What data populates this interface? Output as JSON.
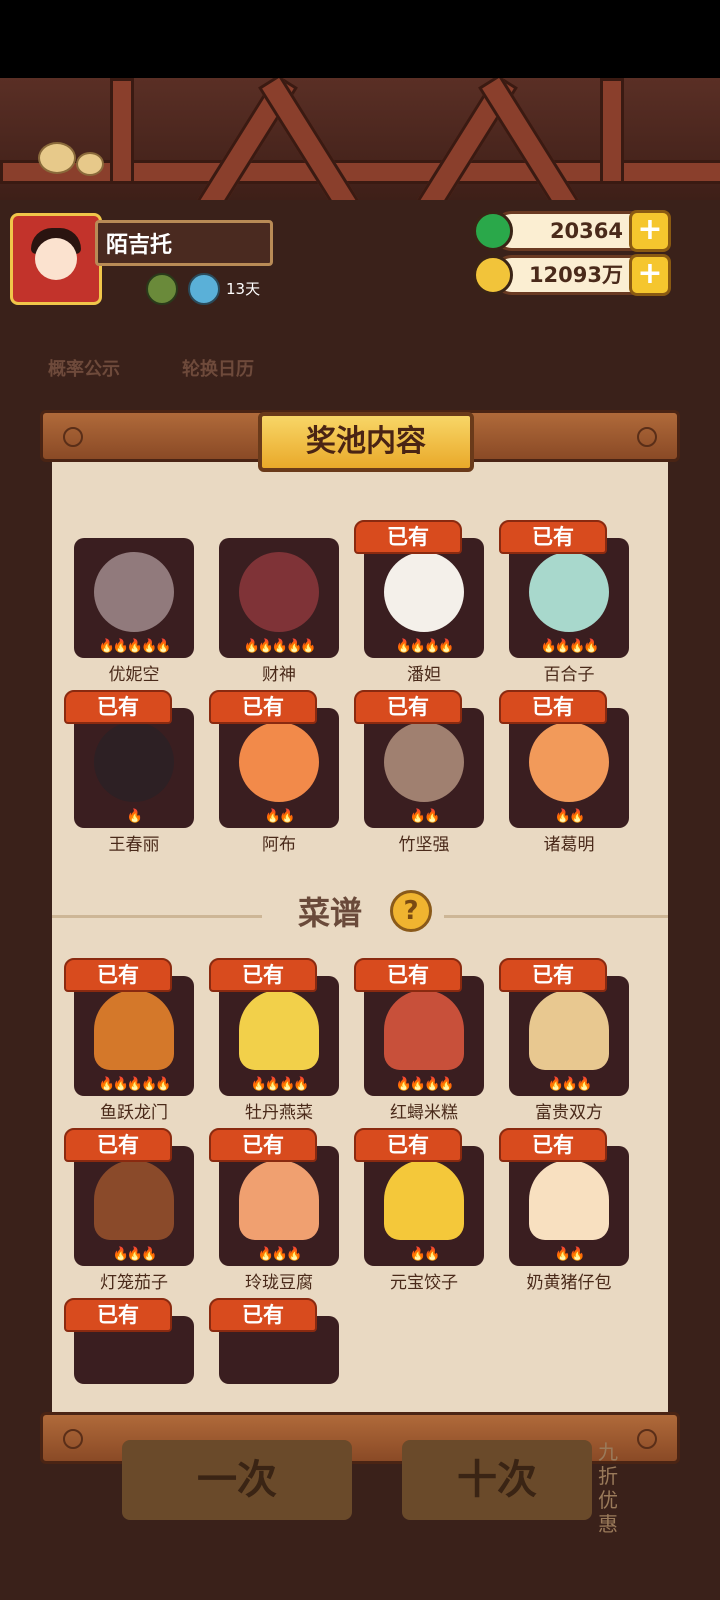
{
  "profile": {
    "name": "陌吉托",
    "days": "13天"
  },
  "currency": {
    "jade": "20364",
    "coins": "12093万",
    "plus": "+"
  },
  "background": {
    "probability": "概率公示",
    "calendar": "轮换日历",
    "single": "一次",
    "ten": "十次",
    "discount": "九折优惠"
  },
  "panel_title": "奖池内容",
  "owned_label": "已有",
  "characters": [
    {
      "name": "优妮空",
      "owned": false,
      "stars": 5,
      "color": "#d8c7c8",
      "faded": true
    },
    {
      "name": "财神",
      "owned": false,
      "stars": 5,
      "color": "#b8454a",
      "faded": true
    },
    {
      "name": "潘妲",
      "owned": true,
      "stars": 4,
      "color": "#f4f0ea",
      "faded": false
    },
    {
      "name": "百合子",
      "owned": true,
      "stars": 4,
      "color": "#a8d8cc",
      "faded": false
    },
    {
      "name": "王春丽",
      "owned": true,
      "stars": 1,
      "color": "#2d2024",
      "faded": false
    },
    {
      "name": "阿布",
      "owned": true,
      "stars": 2,
      "color": "#f28a4a",
      "faded": false
    },
    {
      "name": "竹坚强",
      "owned": true,
      "stars": 2,
      "color": "#a08070",
      "faded": false
    },
    {
      "name": "诸葛明",
      "owned": true,
      "stars": 2,
      "color": "#f29a5a",
      "faded": false
    }
  ],
  "recipe_title": "菜谱",
  "help_icon": "?",
  "recipes": [
    {
      "name": "鱼跃龙门",
      "owned": true,
      "stars": 5,
      "color": "#d4782a"
    },
    {
      "name": "牡丹燕菜",
      "owned": true,
      "stars": 4,
      "color": "#f2d04a"
    },
    {
      "name": "红蟳米糕",
      "owned": true,
      "stars": 4,
      "color": "#c8503a"
    },
    {
      "name": "富贵双方",
      "owned": true,
      "stars": 3,
      "color": "#e8c890"
    },
    {
      "name": "灯笼茄子",
      "owned": true,
      "stars": 3,
      "color": "#8a4a2a"
    },
    {
      "name": "玲珑豆腐",
      "owned": true,
      "stars": 3,
      "color": "#f0a070"
    },
    {
      "name": "元宝饺子",
      "owned": true,
      "stars": 2,
      "color": "#f4c83a"
    },
    {
      "name": "奶黄猪仔包",
      "owned": true,
      "stars": 2,
      "color": "#f8e0c0"
    },
    {
      "name": "",
      "owned": true,
      "stars": 0,
      "color": "#3a1e20"
    },
    {
      "name": "",
      "owned": true,
      "stars": 0,
      "color": "#3a1e20"
    }
  ]
}
